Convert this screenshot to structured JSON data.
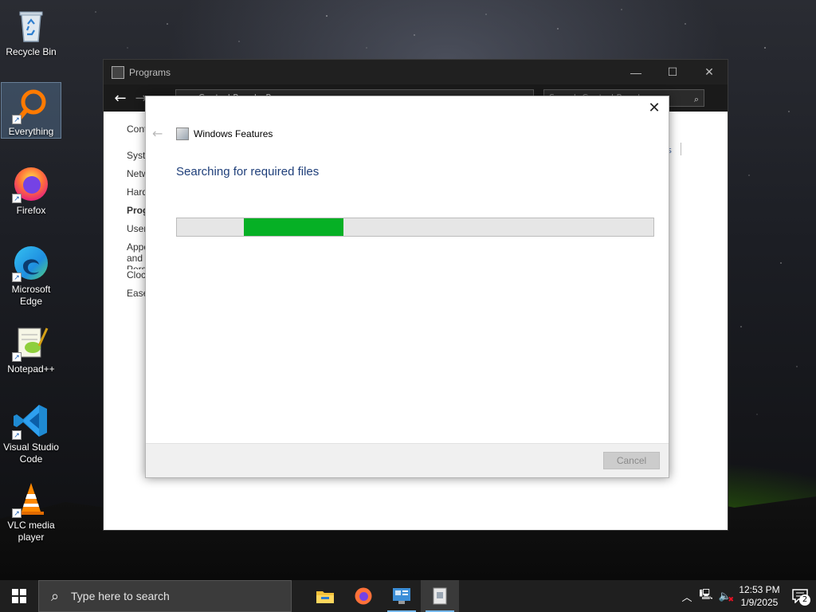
{
  "desktop": {
    "icons": [
      {
        "label": "Recycle Bin"
      },
      {
        "label": "Everything"
      },
      {
        "label": "Firefox"
      },
      {
        "label": "Microsoft Edge"
      },
      {
        "label": "Notepad++"
      },
      {
        "label": "Visual Studio Code"
      },
      {
        "label": "VLC media player"
      }
    ]
  },
  "control_panel": {
    "title": "Programs",
    "address": "Control Panel › Programs",
    "search_placeholder": "Search Control Panel",
    "sidebar": [
      "Control Panel Home",
      "System and Security",
      "Network and Internet",
      "Hardware and Sound",
      "Programs",
      "User Accounts",
      "Appearance and Personalization",
      "Clock and Region",
      "Ease of Access"
    ],
    "sidebar_active": "Programs",
    "right_link": "s"
  },
  "windows_features": {
    "title": "Windows Features",
    "status": "Searching for required files",
    "cancel_label": "Cancel",
    "progress": {
      "start": 0.14,
      "end": 0.35
    },
    "accent": "#06b025"
  },
  "taskbar": {
    "search_placeholder": "Type here to search",
    "apps": [
      "file-explorer-icon",
      "firefox-icon",
      "control-panel-icon",
      "windows-features-icon"
    ],
    "time": "12:53 PM",
    "date": "1/9/2025",
    "notification_count": "2"
  }
}
